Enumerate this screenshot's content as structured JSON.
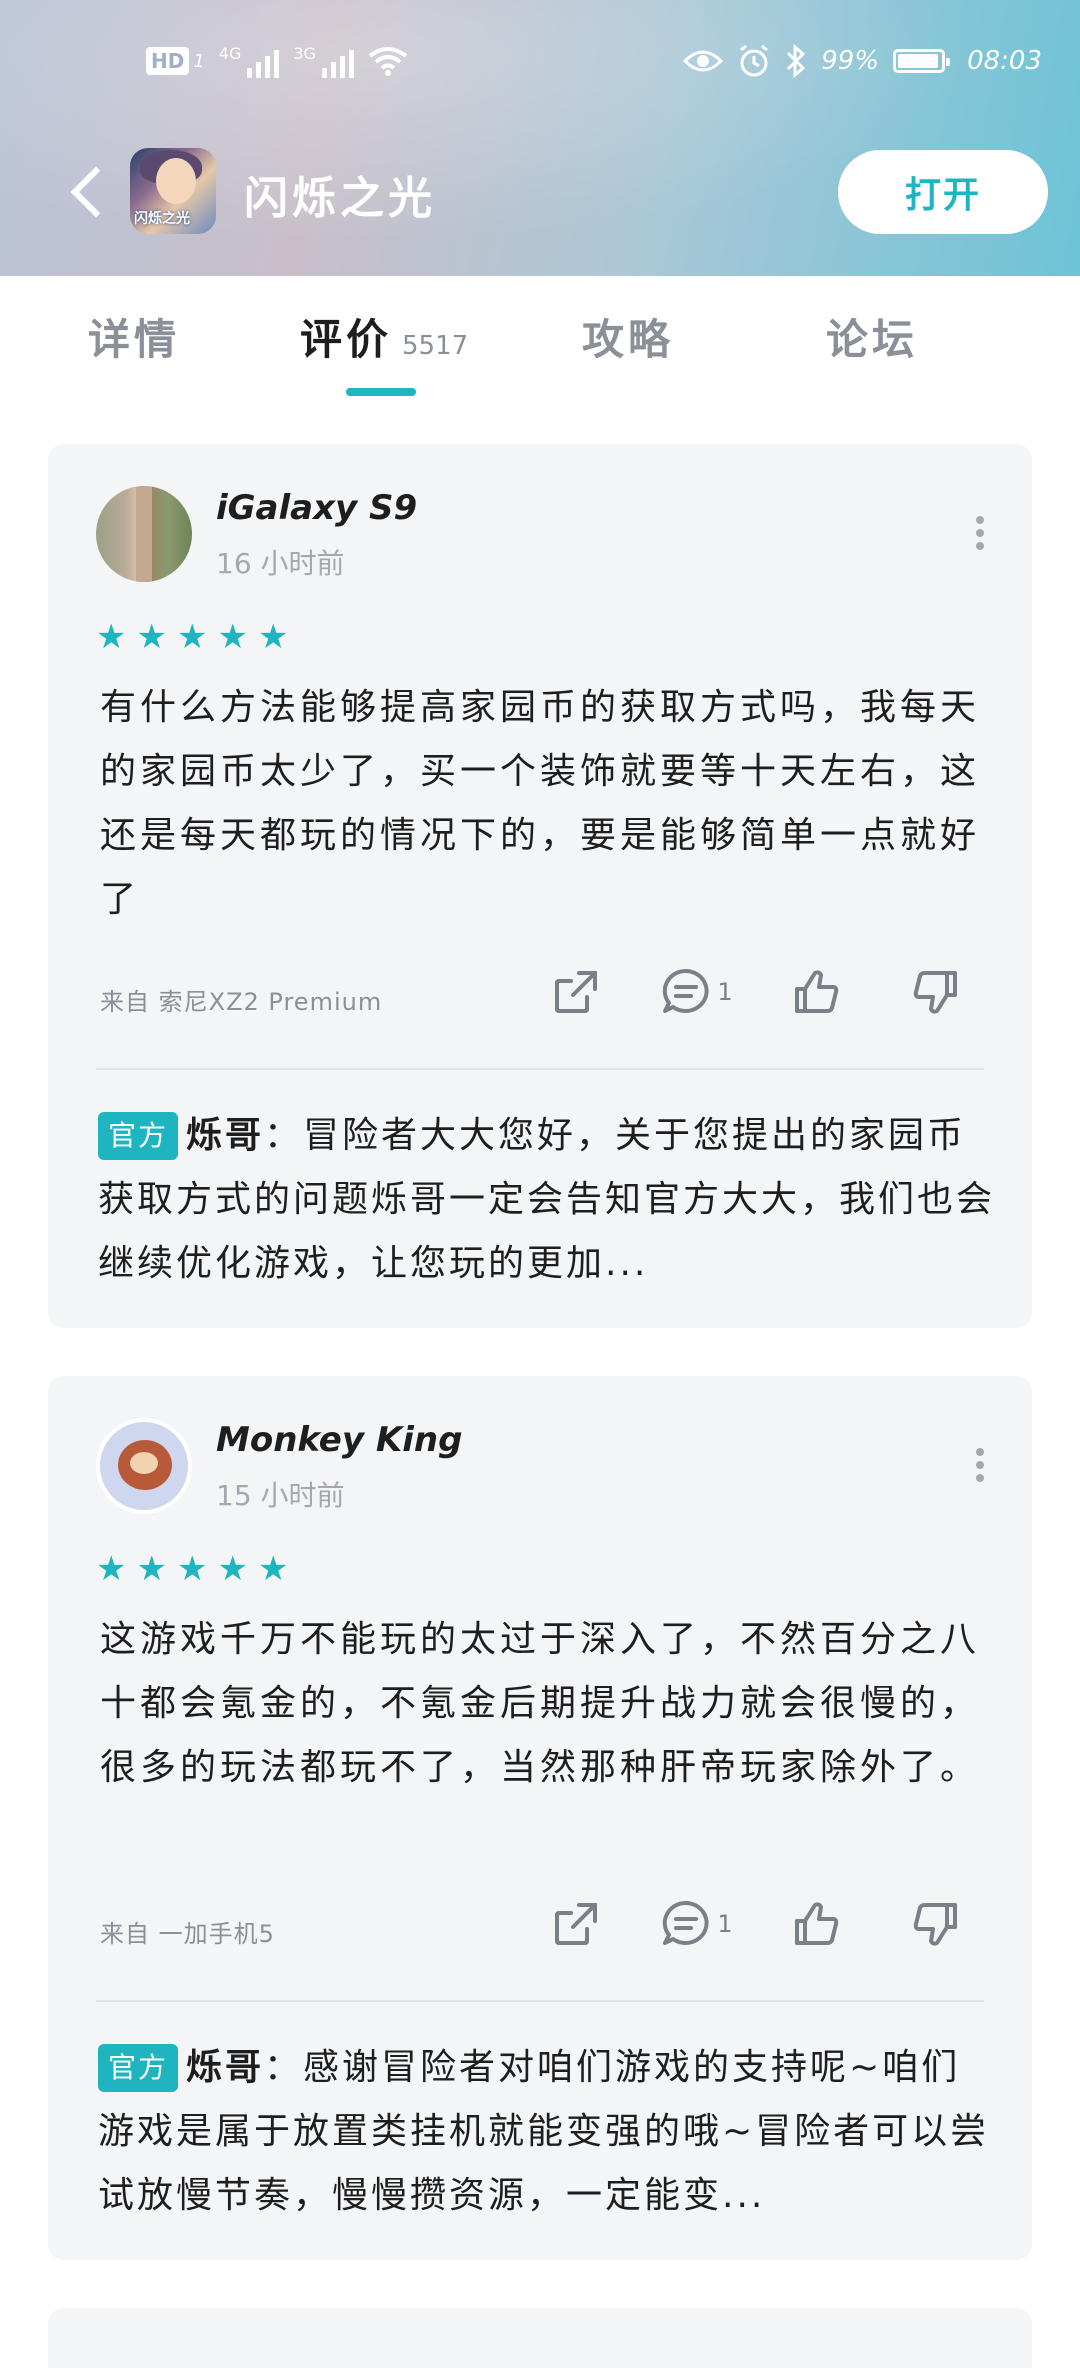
{
  "status_bar": {
    "hd": "HD",
    "sim": "1",
    "net1": "4G",
    "net2": "3G",
    "battery": "99%",
    "time": "08:03"
  },
  "titlebar": {
    "app_name": "闪烁之光",
    "open_button": "打开",
    "icon_logo": "闪烁之光"
  },
  "tabs": [
    {
      "label": "详情"
    },
    {
      "label": "评价",
      "count": "5517"
    },
    {
      "label": "攻略"
    },
    {
      "label": "论坛"
    }
  ],
  "reviews": [
    {
      "user": "iGalaxy S9",
      "time": "16 小时前",
      "rating": 5,
      "text": "有什么方法能够提高家园币的获取方式吗，我每天的家园币太少了，买一个装饰就要等十天左右，这还是每天都玩的情况下的，要是能够简单一点就好了",
      "device": "来自 索尼XZ2 Premium",
      "comments": "1",
      "reply_badge": "官方",
      "reply_author": "烁哥",
      "reply_text": "：冒险者大大您好，关于您提出的家园币获取方式的问题烁哥一定会告知官方大大，我们也会继续优化游戏，让您玩的更加..."
    },
    {
      "user": "Monkey King",
      "time": "15 小时前",
      "rating": 5,
      "text": "这游戏千万不能玩的太过于深入了，不然百分之八十都会氪金的，不氪金后期提升战力就会很慢的，很多的玩法都玩不了，当然那种肝帝玩家除外了。",
      "device": "来自 一加手机5",
      "comments": "1",
      "reply_badge": "官方",
      "reply_author": "烁哥",
      "reply_text": "：感谢冒险者对咱们游戏的支持呢~咱们游戏是属于放置类挂机就能变强的哦~冒险者可以尝试放慢节奏，慢慢攒资源，一定能变..."
    }
  ],
  "colors": {
    "accent": "#1fb5c0",
    "card_bg": "#f4f5f7",
    "muted_text": "#a3a8b0"
  }
}
